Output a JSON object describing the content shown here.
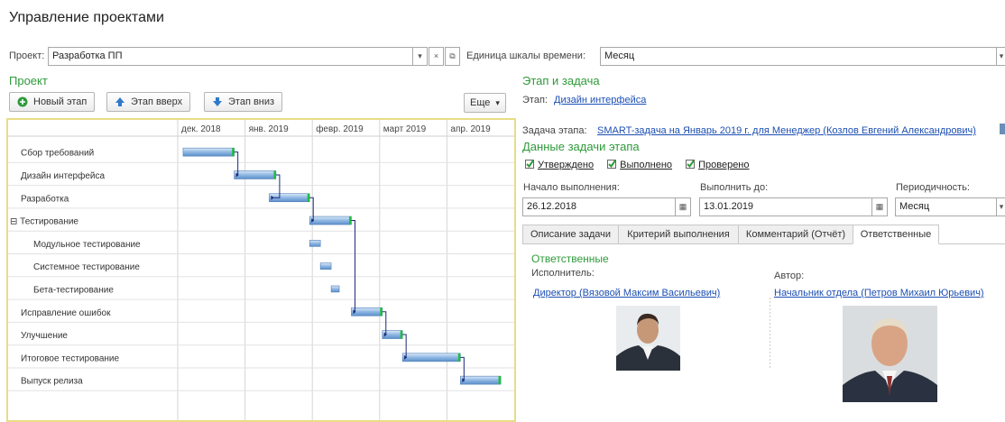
{
  "page_title": "Управление проектами",
  "project_field": {
    "label": "Проект:",
    "value": "Разработка ПП"
  },
  "time_unit": {
    "label": "Единица шкалы времени:",
    "value": "Месяц"
  },
  "left_section_title": "Проект",
  "toolbar": {
    "new_stage": "Новый этап",
    "stage_up": "Этап вверх",
    "stage_down": "Этап вниз",
    "more": "Еще"
  },
  "gantt": {
    "months": [
      "дек. 2018",
      "янв. 2019",
      "февр. 2019",
      "март 2019",
      "апр. 2019"
    ],
    "tasks": [
      {
        "name": "Сбор требований",
        "level": 0,
        "start": 0.08,
        "end": 0.84
      },
      {
        "name": "Дизайн интерфейса",
        "level": 0,
        "start": 0.84,
        "end": 1.46
      },
      {
        "name": "Разработка",
        "level": 0,
        "start": 1.36,
        "end": 1.96
      },
      {
        "name": "Тестирование",
        "level": 0,
        "group": true,
        "expander": "⊟",
        "start": 1.96,
        "end": 2.58
      },
      {
        "name": "Модульное тестирование",
        "level": 1,
        "start": 1.96,
        "end": 2.12
      },
      {
        "name": "Системное тестирование",
        "level": 1,
        "start": 2.12,
        "end": 2.28
      },
      {
        "name": "Бета-тестирование",
        "level": 1,
        "start": 2.28,
        "end": 2.4
      },
      {
        "name": "Исправление ошибок",
        "level": 0,
        "start": 2.58,
        "end": 3.04
      },
      {
        "name": "Улучшение",
        "level": 0,
        "start": 3.04,
        "end": 3.34
      },
      {
        "name": "Итоговое тестирование",
        "level": 0,
        "start": 3.34,
        "end": 4.2
      },
      {
        "name": "Выпуск релиза",
        "level": 0,
        "start": 4.2,
        "end": 4.8
      }
    ]
  },
  "right_section_title": "Этап и задача",
  "stage": {
    "label": "Этап:",
    "value": "Дизайн интерфейса"
  },
  "stage_task": {
    "label": "Задача этапа:",
    "value": "SMART-задача на Январь 2019 г. для Менеджер (Козлов Евгений Александрович)"
  },
  "stage_data_title": "Данные задачи этапа",
  "checkboxes": [
    "Утверждено",
    "Выполнено",
    "Проверено"
  ],
  "start_date": {
    "label": "Начало выполнения:",
    "value": "26.12.2018"
  },
  "due_date": {
    "label": "Выполнить до:",
    "value": "13.01.2019"
  },
  "periodicity": {
    "label": "Периодичность:",
    "value": "Месяц"
  },
  "tabs": [
    "Описание задачи",
    "Критерий выполнения",
    "Комментарий (Отчёт)",
    "Ответственные"
  ],
  "responsible": {
    "title": "Ответственные",
    "executor_label": "Исполнитель:",
    "executor": "Директор (Вязовой Максим Васильевич)",
    "author_label": "Автор:",
    "author": "Начальник отдела (Петров Михаил Юрьевич)"
  },
  "colors": {
    "accent_green": "#2e9a3a",
    "link": "#1c4fb3",
    "bar": "#8fb7e3",
    "bar_end": "#1fbf3c",
    "frame": "#e8dc86"
  },
  "icons": [
    "plus-circle-icon",
    "arrow-up-icon",
    "arrow-down-icon",
    "dropdown-icon",
    "clear-icon",
    "open-icon",
    "calendar-icon",
    "checkbox-checked-icon"
  ]
}
